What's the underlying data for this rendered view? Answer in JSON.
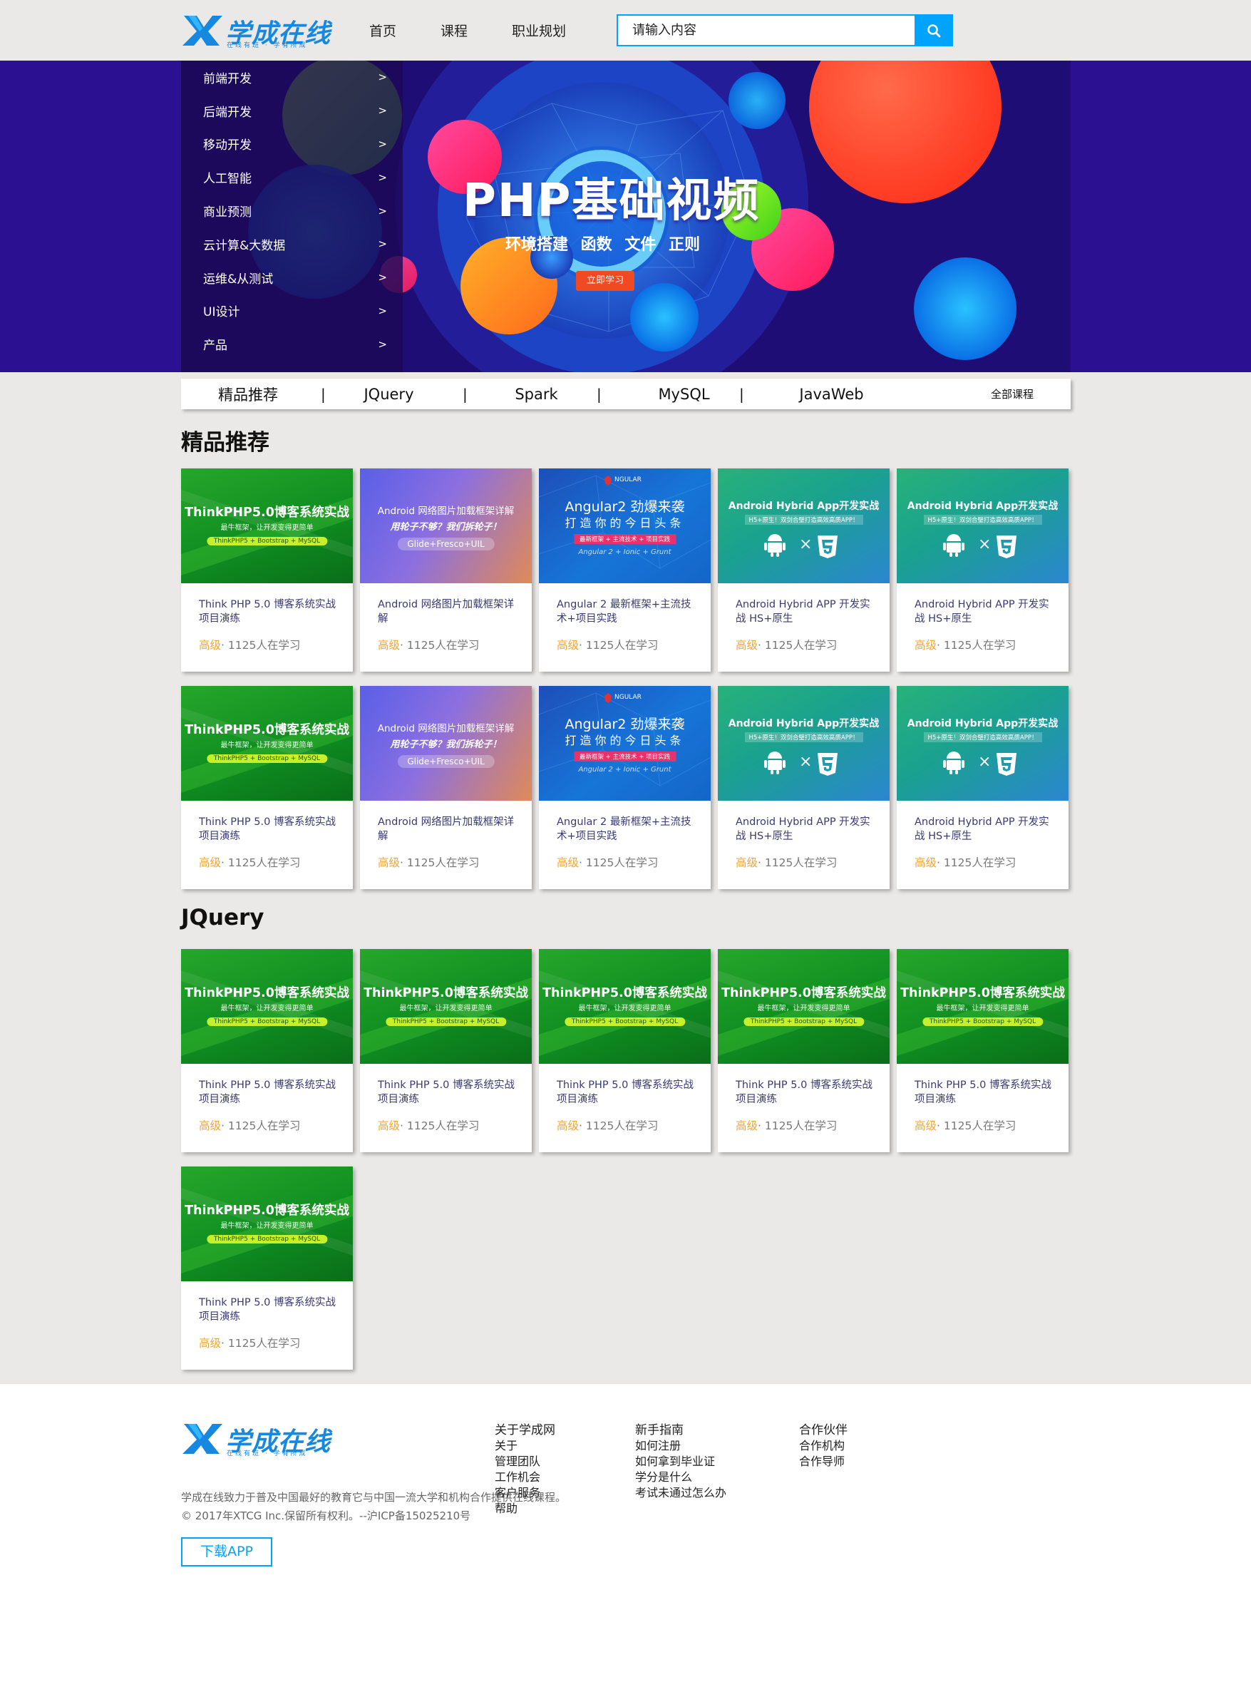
{
  "header": {
    "logo_text": "学成在线",
    "logo_sub": "在线有班 · 学有所成",
    "nav": [
      "首页",
      "课程",
      "职业规划"
    ],
    "search_placeholder": "请输入内容"
  },
  "banner": {
    "title": "PHP基础视频",
    "subtitle": "环境搭建  函数  文件  正则",
    "button": "立即学习",
    "menu": [
      "前端开发",
      "后端开发",
      "移动开发",
      "人工智能",
      "商业预测",
      "云计算&大数据",
      "运维&从测试",
      "UI设计",
      "产品"
    ],
    "menu_arrow": ">"
  },
  "tabs": {
    "items": [
      "精品推荐",
      "JQuery",
      "Spark",
      "MySQL",
      "JavaWeb"
    ],
    "separator": "|",
    "all": "全部课程"
  },
  "sections": [
    {
      "title": "精品推荐",
      "cards": [
        {
          "type": "php",
          "title": "Think PHP 5.0 博客系统实战项目演练",
          "level": "高级",
          "learners": "· 1125人在学习"
        },
        {
          "type": "android",
          "title": "Android 网络图片加载框架详解",
          "level": "高级",
          "learners": "· 1125人在学习"
        },
        {
          "type": "angular",
          "title": "Angular 2 最新框架+主流技术+项目实践",
          "level": "高级",
          "learners": "· 1125人在学习"
        },
        {
          "type": "hybrid",
          "title": "Android Hybrid APP 开发实战 HS+原生",
          "level": "高级",
          "learners": "· 1125人在学习"
        },
        {
          "type": "hybrid",
          "title": "Android Hybrid APP 开发实战 HS+原生",
          "level": "高级",
          "learners": "· 1125人在学习"
        },
        {
          "type": "php",
          "title": "Think PHP 5.0 博客系统实战项目演练",
          "level": "高级",
          "learners": "· 1125人在学习"
        },
        {
          "type": "android",
          "title": "Android 网络图片加载框架详解",
          "level": "高级",
          "learners": "· 1125人在学习"
        },
        {
          "type": "angular",
          "title": "Angular 2 最新框架+主流技术+项目实践",
          "level": "高级",
          "learners": "· 1125人在学习"
        },
        {
          "type": "hybrid",
          "title": "Android Hybrid APP 开发实战 HS+原生",
          "level": "高级",
          "learners": "· 1125人在学习"
        },
        {
          "type": "hybrid",
          "title": "Android Hybrid APP 开发实战 HS+原生",
          "level": "高级",
          "learners": "· 1125人在学习"
        }
      ]
    },
    {
      "title": "JQuery",
      "cards": [
        {
          "type": "php",
          "title": "Think PHP 5.0 博客系统实战项目演练",
          "level": "高级",
          "learners": "· 1125人在学习"
        },
        {
          "type": "php",
          "title": "Think PHP 5.0 博客系统实战项目演练",
          "level": "高级",
          "learners": "· 1125人在学习"
        },
        {
          "type": "php",
          "title": "Think PHP 5.0 博客系统实战项目演练",
          "level": "高级",
          "learners": "· 1125人在学习"
        },
        {
          "type": "php",
          "title": "Think PHP 5.0 博客系统实战项目演练",
          "level": "高级",
          "learners": "· 1125人在学习"
        },
        {
          "type": "php",
          "title": "Think PHP 5.0 博客系统实战项目演练",
          "level": "高级",
          "learners": "· 1125人在学习"
        },
        {
          "type": "php",
          "title": "Think PHP 5.0 博客系统实战项目演练",
          "level": "高级",
          "learners": "· 1125人在学习"
        }
      ]
    }
  ],
  "thumbs": {
    "php": {
      "t1": "ThinkPHP5.0博客系统实战",
      "t2": "最牛框架，让开发变得更简单",
      "pill": "ThinkPHP5 + Bootstrap + MySQL"
    },
    "android": {
      "t1": "Android 网络图片加载框架详解",
      "t2": "用轮子不够？我们拆轮子！",
      "pill": "Glide+Fresco+UIL"
    },
    "angular": {
      "brand": "NGULAR",
      "t1": "Angular2 劲爆来袭",
      "t2": "打造你的今日头条",
      "pill": "最新框架 + 主流技术 + 项目实践",
      "t3": "Angular 2 + Ionic + Grunt"
    },
    "hybrid": {
      "t1": "Android Hybrid App开发实战",
      "t2": "H5+原生！双剑合璧打造高效高质APP！",
      "x": "×",
      "h5": "5"
    }
  },
  "footer": {
    "logo_text": "学成在线",
    "logo_sub": "在线有班 · 学有所成",
    "desc1": "学成在线致力于普及中国最好的教育它与中国一流大学和机构合作提供在线课程。",
    "desc2": "© 2017年XTCG Inc.保留所有权利。--沪ICP备15025210号",
    "download": "下载APP",
    "columns": [
      {
        "title": "关于学成网",
        "items": [
          "关于",
          "管理团队",
          "工作机会",
          "客户服务",
          "帮助"
        ]
      },
      {
        "title": "新手指南",
        "items": [
          "如何注册",
          "如何拿到毕业证",
          "学分是什么",
          "考试未通过怎么办"
        ]
      },
      {
        "title": "合作伙伴",
        "items": [
          "合作机构",
          "合作导师"
        ]
      }
    ]
  },
  "colors": {
    "accent": "#00a4ff",
    "level": "#f3a533",
    "banner_bg": "#2b1191"
  }
}
